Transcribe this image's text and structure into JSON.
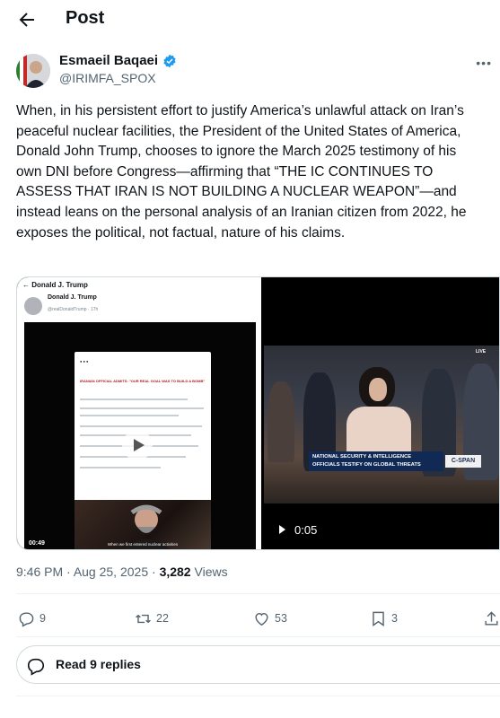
{
  "header": {
    "title": "Post"
  },
  "author": {
    "name": "Esmaeil Baqaei",
    "handle": "@IRIMFA_SPOX",
    "verified_color": "#1d9bf0",
    "more_icon": "more-dots-icon"
  },
  "post": {
    "text": "When, in his persistent effort to justify America’s unlawful attack on Iran’s peaceful nuclear facilities, the President of the United States of America, Donald John Trump, chooses to ignore the March 2025 testimony of his own DNI before Congress—affirming that “THE IC CONTINUES TO ASSESS THAT IRAN IS NOT BUILDING A NUCLEAR WEAPON”—and instead leans on the personal analysis of an Iranian citizen from 2022, he exposes the political, not factual, nature of his claims."
  },
  "media": {
    "left": {
      "top_label": "← Donald J. Trump",
      "author": "Donald J. Trump",
      "handle": "@realDonaldTrump · 17h",
      "card_headline": "IRANIAN OFFICIAL ADMITS: \"OUR REAL GOAL WAS TO BUILD A BOMB\"",
      "card_caption": "When we first entered nuclear activities",
      "duration": "00:49"
    },
    "right": {
      "lower_third_line1": "NATIONAL SECURITY & INTELLIGENCE",
      "lower_third_line2": "OFFICIALS TESTIFY ON GLOBAL THREATS",
      "network": "C-SPAN",
      "live_tag": "LIVE",
      "duration": "0:05"
    }
  },
  "meta": {
    "time": "9:46 PM",
    "date": "Aug 25, 2025",
    "views_count": "3,282",
    "views_label": "Views"
  },
  "actions": {
    "replies": "9",
    "reposts": "22",
    "likes": "53",
    "bookmarks": "3"
  },
  "replies_button": {
    "label": "Read 9 replies"
  },
  "colors": {
    "text": "#0f1419",
    "secondary": "#536471",
    "border": "#cfd9de",
    "accent": "#1d9bf0"
  }
}
